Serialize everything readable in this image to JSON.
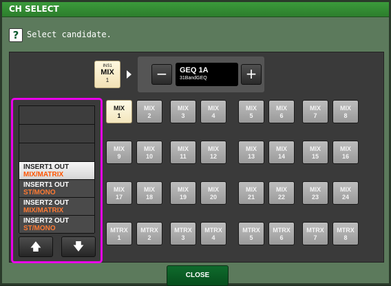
{
  "window": {
    "title": "CH SELECT"
  },
  "prompt": {
    "icon": "question-icon",
    "glyph": "?",
    "text": "Select candidate."
  },
  "source": {
    "line1": "INS1",
    "line2": "MIX",
    "line3": "1"
  },
  "selector": {
    "minus": "−",
    "plus": "+",
    "name": "GEQ 1A",
    "sub": "31BandGEQ"
  },
  "list": {
    "items": [
      {
        "a": "",
        "b": ""
      },
      {
        "a": "",
        "b": ""
      },
      {
        "a": "",
        "b": ""
      },
      {
        "a": "INSERT1 OUT",
        "b": "MIX/MATRIX"
      },
      {
        "a": "INSERT1 OUT",
        "b": "ST/MONO"
      },
      {
        "a": "INSERT2 OUT",
        "b": "MIX/MATRIX"
      },
      {
        "a": "INSERT2 OUT",
        "b": "ST/MONO"
      }
    ],
    "up": "🡅",
    "down": "🡇"
  },
  "grid": {
    "buttons": [
      {
        "a": "MIX",
        "n": "1"
      },
      {
        "a": "MIX",
        "n": "2"
      },
      {
        "a": "MIX",
        "n": "3"
      },
      {
        "a": "MIX",
        "n": "4"
      },
      {
        "a": "MIX",
        "n": "5"
      },
      {
        "a": "MIX",
        "n": "6"
      },
      {
        "a": "MIX",
        "n": "7"
      },
      {
        "a": "MIX",
        "n": "8"
      },
      {
        "a": "MIX",
        "n": "9"
      },
      {
        "a": "MIX",
        "n": "10"
      },
      {
        "a": "MIX",
        "n": "11"
      },
      {
        "a": "MIX",
        "n": "12"
      },
      {
        "a": "MIX",
        "n": "13"
      },
      {
        "a": "MIX",
        "n": "14"
      },
      {
        "a": "MIX",
        "n": "15"
      },
      {
        "a": "MIX",
        "n": "16"
      },
      {
        "a": "MIX",
        "n": "17"
      },
      {
        "a": "MIX",
        "n": "18"
      },
      {
        "a": "MIX",
        "n": "19"
      },
      {
        "a": "MIX",
        "n": "20"
      },
      {
        "a": "MIX",
        "n": "21"
      },
      {
        "a": "MIX",
        "n": "22"
      },
      {
        "a": "MIX",
        "n": "23"
      },
      {
        "a": "MIX",
        "n": "24"
      },
      {
        "a": "MTRX",
        "n": "1"
      },
      {
        "a": "MTRX",
        "n": "2"
      },
      {
        "a": "MTRX",
        "n": "3"
      },
      {
        "a": "MTRX",
        "n": "4"
      },
      {
        "a": "MTRX",
        "n": "5"
      },
      {
        "a": "MTRX",
        "n": "6"
      },
      {
        "a": "MTRX",
        "n": "7"
      },
      {
        "a": "MTRX",
        "n": "8"
      }
    ]
  },
  "close": {
    "label": "CLOSE"
  },
  "colors": {
    "accent": "#ea00ea",
    "title": "#2c7e2c",
    "close": "#0f6a2c"
  }
}
